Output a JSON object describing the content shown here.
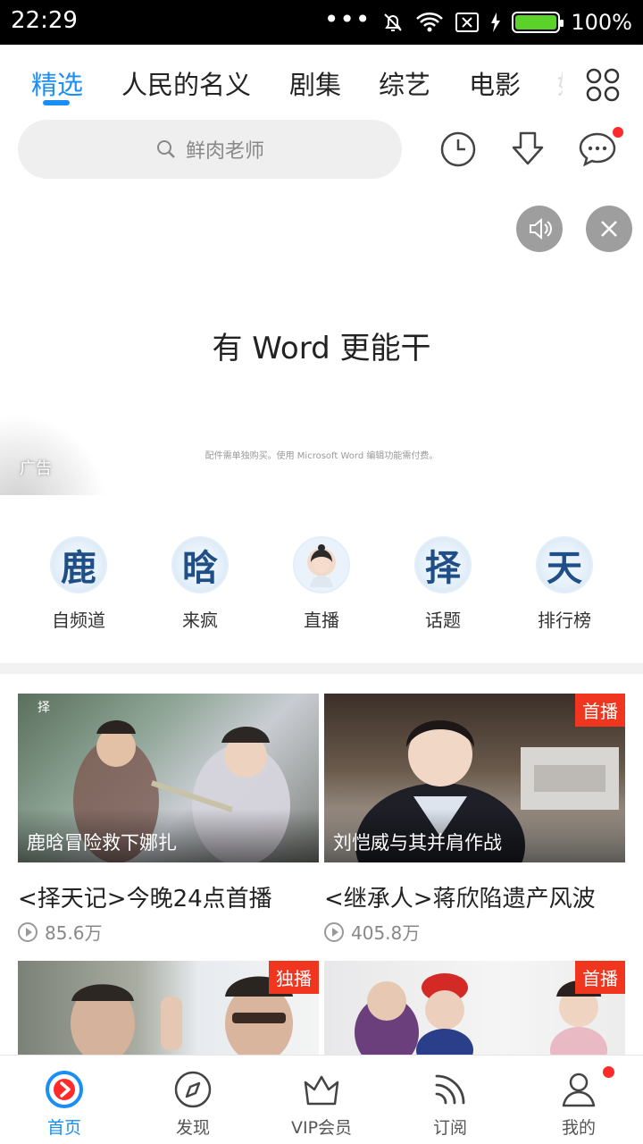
{
  "status_bar": {
    "time": "22:29",
    "battery": "100%"
  },
  "tabs": [
    {
      "label": "精选",
      "active": true
    },
    {
      "label": "人民的名义",
      "active": false
    },
    {
      "label": "剧集",
      "active": false
    },
    {
      "label": "综艺",
      "active": false
    },
    {
      "label": "电影",
      "active": false
    },
    {
      "label": "娱",
      "active": false
    }
  ],
  "search": {
    "placeholder": "鲜肉老师"
  },
  "banner": {
    "headline": "有 Word 更能干",
    "fine_print": "配件需单独购买。使用 Microsoft Word 编辑功能需付费。",
    "ad_label": "广告"
  },
  "quick_links": [
    {
      "label": "自频道",
      "glyph": "鹿"
    },
    {
      "label": "来疯",
      "glyph": "晗"
    },
    {
      "label": "直播",
      "glyph": ""
    },
    {
      "label": "话题",
      "glyph": "择"
    },
    {
      "label": "排行榜",
      "glyph": "天"
    }
  ],
  "videos": [
    {
      "caption": "鹿晗冒险救下娜扎",
      "title": "<择天记>今晚24点首播",
      "views": "85.6万",
      "badge": ""
    },
    {
      "caption": "刘恺威与其并肩作战",
      "title": "<继承人>蒋欣陷遗产风波",
      "views": "405.8万",
      "badge": "首播"
    },
    {
      "caption": "",
      "title": "",
      "views": "",
      "badge": "独播"
    },
    {
      "caption": "",
      "title": "",
      "views": "",
      "badge": "首播"
    }
  ],
  "bottom_nav": [
    {
      "label": "首页",
      "active": true
    },
    {
      "label": "发现",
      "active": false
    },
    {
      "label": "VIP会员",
      "active": false
    },
    {
      "label": "订阅",
      "active": false
    },
    {
      "label": "我的",
      "active": false
    }
  ],
  "colors": {
    "accent": "#1a8ef3",
    "badge": "#f0361f",
    "notification": "#ff2a2a"
  }
}
